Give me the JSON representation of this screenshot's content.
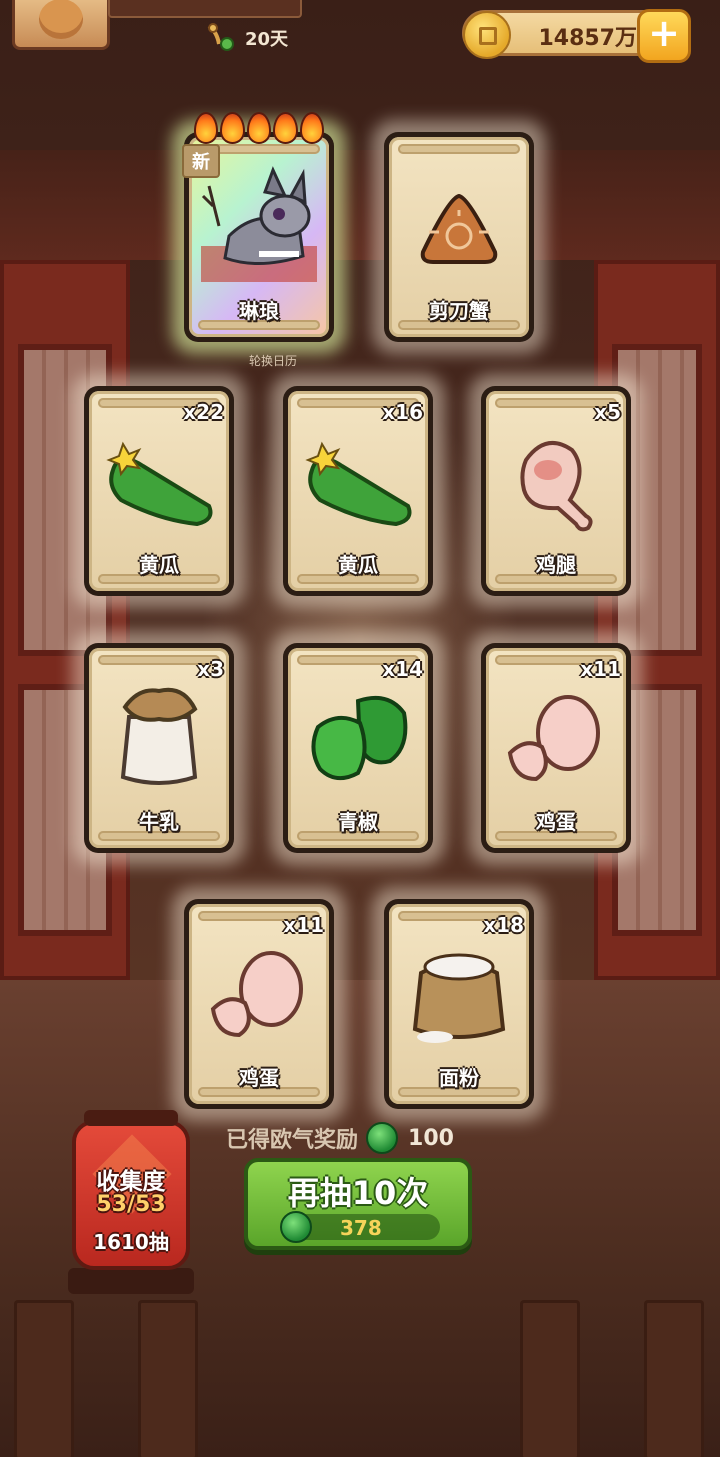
{
  "header": {
    "days_label": "20天",
    "coins": "14857万",
    "plus_label": "+"
  },
  "cards": [
    {
      "name": "琳琅",
      "count": "",
      "new_badge": "新",
      "rare": true,
      "stars": 5,
      "icon": "wolf-character-icon"
    },
    {
      "name": "剪刀蟹",
      "count": "",
      "icon": "crab-cookie-icon"
    },
    {
      "name": "黄瓜",
      "count": "x22",
      "icon": "cucumber-icon"
    },
    {
      "name": "黄瓜",
      "count": "x16",
      "icon": "cucumber-icon"
    },
    {
      "name": "鸡腿",
      "count": "x5",
      "icon": "drumstick-icon"
    },
    {
      "name": "牛乳",
      "count": "x3",
      "icon": "milk-jar-icon"
    },
    {
      "name": "青椒",
      "count": "x14",
      "icon": "green-pepper-icon"
    },
    {
      "name": "鸡蛋",
      "count": "x11",
      "icon": "egg-icon"
    },
    {
      "name": "鸡蛋",
      "count": "x11",
      "icon": "egg-icon"
    },
    {
      "name": "面粉",
      "count": "x18",
      "icon": "flour-sack-icon"
    }
  ],
  "sublabel": "轮换日历",
  "collection": {
    "title": "收集度",
    "progress": "53/53",
    "draws": "1610抽"
  },
  "bonus": {
    "label": "已得欧气奖励",
    "value": "100"
  },
  "draw_button": {
    "label": "再抽10次",
    "cost": "378"
  }
}
